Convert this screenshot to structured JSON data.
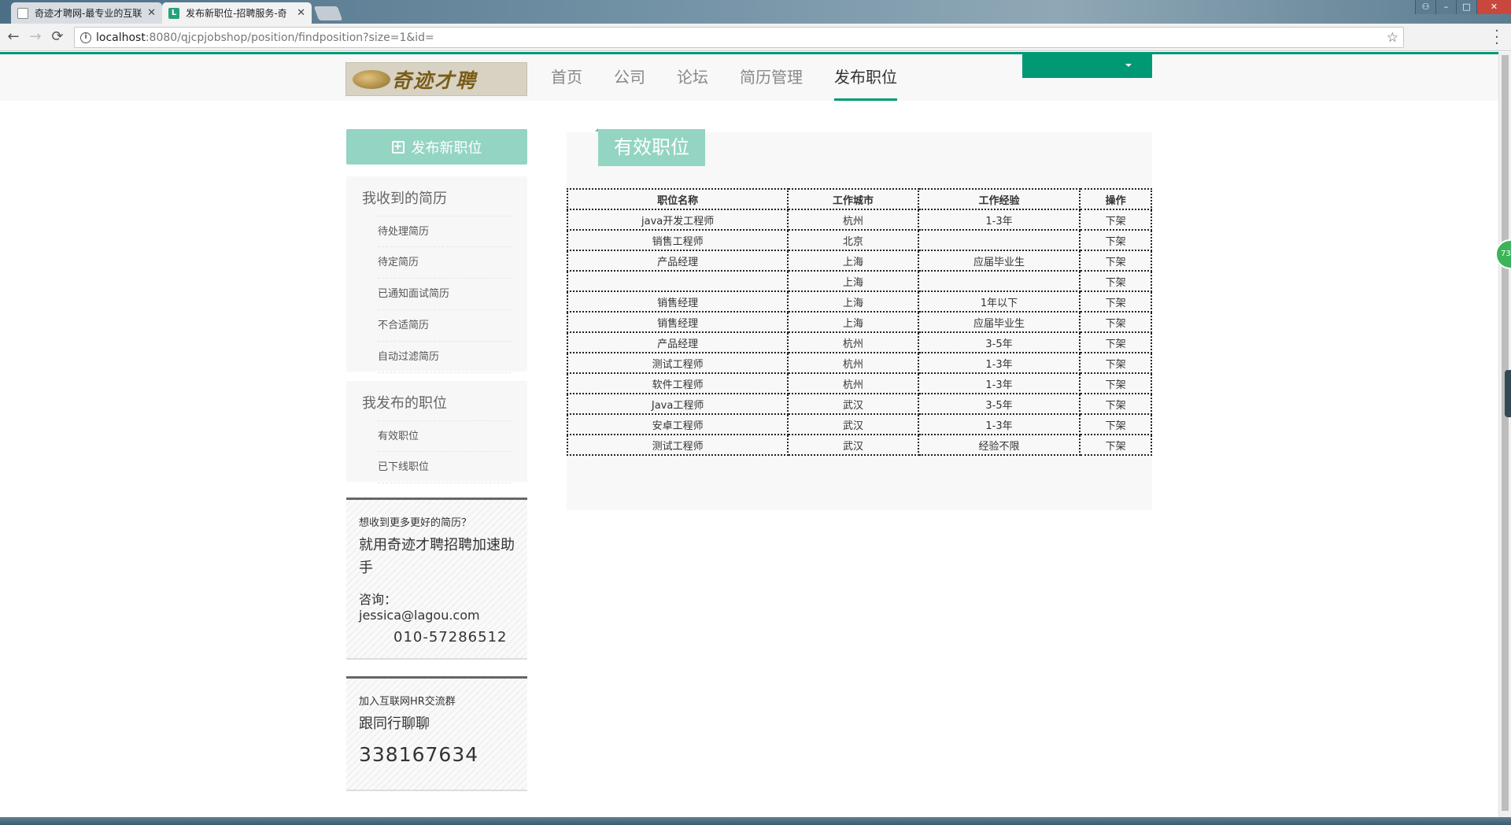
{
  "browser": {
    "tabs": [
      {
        "title": "奇迹才聘网-最专业的互联",
        "active": false
      },
      {
        "title": "发布新职位-招聘服务-奇",
        "active": true
      }
    ],
    "url_host": "localhost",
    "url_path": ":8080/qjcpjobshop/position/findposition?size=1&id=",
    "close_glyph": "✕",
    "back_glyph": "←",
    "forward_glyph": "→",
    "reload_glyph": "⟳",
    "star_glyph": "☆",
    "tab_favicon_letter": "L"
  },
  "header": {
    "logo_text": "奇迹才聘",
    "nav": [
      "首页",
      "公司",
      "论坛",
      "简历管理",
      "发布职位"
    ],
    "active_nav": "发布职位"
  },
  "sidebar": {
    "new_button_label": "发布新职位",
    "resumes": {
      "title": "我收到的简历",
      "items": [
        "待处理简历",
        "待定简历",
        "已通知面试简历",
        "不合适简历",
        "自动过滤简历"
      ]
    },
    "positions": {
      "title": "我发布的职位",
      "items": [
        "有效职位",
        "已下线职位"
      ]
    },
    "promo1": {
      "line1": "想收到更多更好的简历？",
      "line2": "就用奇迹才聘招聘加速助手",
      "contact": "咨询：jessica@lagou.com",
      "phone": "010-57286512"
    },
    "promo2": {
      "line1": "加入互联网HR交流群",
      "line2": "跟同行聊聊",
      "qq": "338167634"
    }
  },
  "main": {
    "tab_title": "有效职位",
    "columns": [
      "职位名称",
      "工作城市",
      "工作经验",
      "操作"
    ],
    "rows": [
      [
        "java开发工程师",
        "杭州",
        "1-3年",
        "下架"
      ],
      [
        "销售工程师",
        "北京",
        "",
        "下架"
      ],
      [
        "产品经理",
        "上海",
        "应届毕业生",
        "下架"
      ],
      [
        "",
        "上海",
        "",
        "下架"
      ],
      [
        "销售经理",
        "上海",
        "1年以下",
        "下架"
      ],
      [
        "销售经理",
        "上海",
        "应届毕业生",
        "下架"
      ],
      [
        "产品经理",
        "杭州",
        "3-5年",
        "下架"
      ],
      [
        "测试工程师",
        "杭州",
        "1-3年",
        "下架"
      ],
      [
        "软件工程师",
        "杭州",
        "1-3年",
        "下架"
      ],
      [
        "Java工程师",
        "武汉",
        "3-5年",
        "下架"
      ],
      [
        "安卓工程师",
        "武汉",
        "1-3年",
        "下架"
      ],
      [
        "测试工程师",
        "武汉",
        "经验不限",
        "下架"
      ]
    ]
  },
  "float_badge": "73",
  "colors": {
    "accent": "#019875",
    "accent_light": "#94d4c3"
  }
}
